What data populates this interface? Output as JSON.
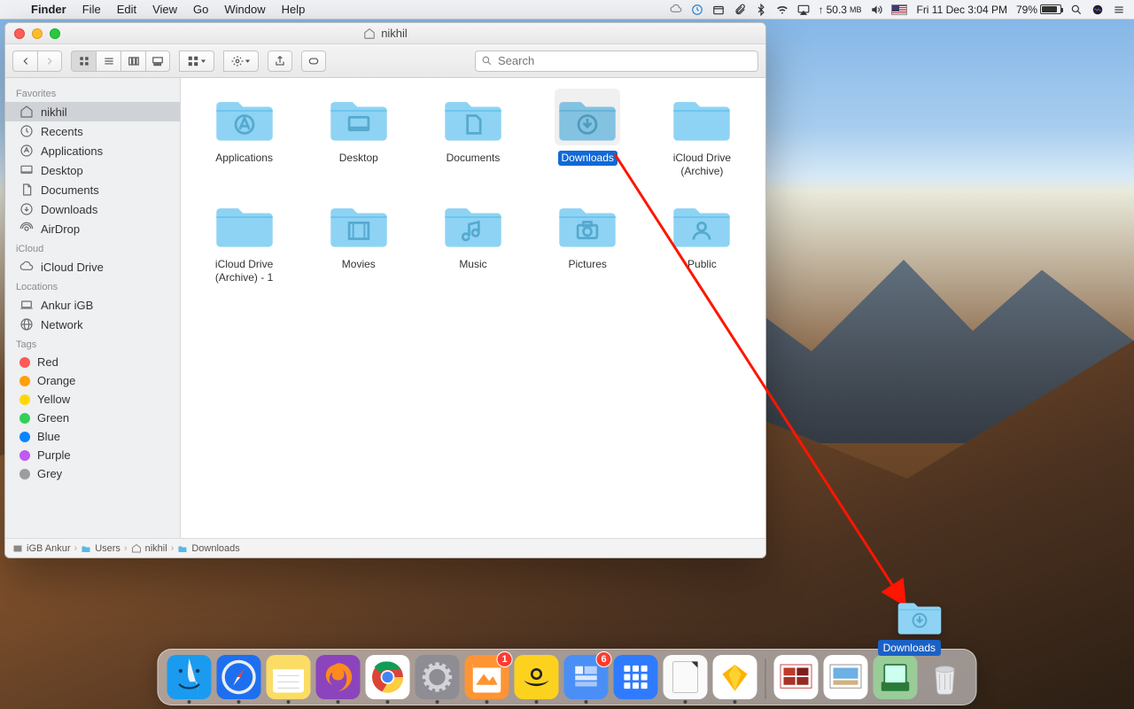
{
  "menubar": {
    "app": "Finder",
    "items": [
      "File",
      "Edit",
      "View",
      "Go",
      "Window",
      "Help"
    ],
    "memory": "50.3",
    "memory_unit": "MB",
    "datetime": "Fri 11 Dec  3:04 PM",
    "battery_pct": "79%"
  },
  "window": {
    "title": "nikhil",
    "search_placeholder": "Search"
  },
  "sidebar": {
    "sections": [
      {
        "title": "Favorites",
        "items": [
          {
            "icon": "home",
            "label": "nikhil",
            "selected": true
          },
          {
            "icon": "clock",
            "label": "Recents"
          },
          {
            "icon": "apps",
            "label": "Applications"
          },
          {
            "icon": "desktop",
            "label": "Desktop"
          },
          {
            "icon": "doc",
            "label": "Documents"
          },
          {
            "icon": "download",
            "label": "Downloads"
          },
          {
            "icon": "airdrop",
            "label": "AirDrop"
          }
        ]
      },
      {
        "title": "iCloud",
        "items": [
          {
            "icon": "cloud",
            "label": "iCloud Drive"
          }
        ]
      },
      {
        "title": "Locations",
        "items": [
          {
            "icon": "laptop",
            "label": "Ankur iGB"
          },
          {
            "icon": "globe",
            "label": "Network"
          }
        ]
      },
      {
        "title": "Tags",
        "items": [
          {
            "tag": "#ff5b56",
            "label": "Red"
          },
          {
            "tag": "#ff9f0a",
            "label": "Orange"
          },
          {
            "tag": "#ffd60a",
            "label": "Yellow"
          },
          {
            "tag": "#30d158",
            "label": "Green"
          },
          {
            "tag": "#0a84ff",
            "label": "Blue"
          },
          {
            "tag": "#bf5af2",
            "label": "Purple"
          },
          {
            "tag": "#9d9ca1",
            "label": "Grey"
          }
        ]
      }
    ]
  },
  "folders": [
    {
      "glyph": "apps",
      "label": "Applications"
    },
    {
      "glyph": "desktop",
      "label": "Desktop"
    },
    {
      "glyph": "doc",
      "label": "Documents"
    },
    {
      "glyph": "download",
      "label": "Downloads",
      "selected": true
    },
    {
      "glyph": "cloud",
      "label": "iCloud Drive (Archive)"
    },
    {
      "glyph": "cloud",
      "label": "iCloud Drive (Archive) - 1"
    },
    {
      "glyph": "movie",
      "label": "Movies"
    },
    {
      "glyph": "music",
      "label": "Music"
    },
    {
      "glyph": "camera",
      "label": "Pictures"
    },
    {
      "glyph": "person",
      "label": "Public"
    }
  ],
  "pathbar": [
    "iGB Ankur",
    "Users",
    "nikhil",
    "Downloads"
  ],
  "dock": {
    "apps": [
      {
        "name": "finder",
        "bg": "#1b9bf0",
        "running": true
      },
      {
        "name": "safari",
        "bg": "#1e6ff0",
        "running": true
      },
      {
        "name": "notes",
        "bg": "#fbdc65",
        "running": true
      },
      {
        "name": "firefox",
        "bg": "#8c44bc",
        "running": true
      },
      {
        "name": "chrome",
        "bg": "#fff",
        "running": true
      },
      {
        "name": "settings",
        "bg": "#8d8d93",
        "running": true
      },
      {
        "name": "pages",
        "bg": "#ff9434",
        "badge": "1",
        "running": true
      },
      {
        "name": "mapper",
        "bg": "#fcd21e",
        "running": true
      },
      {
        "name": "slack",
        "bg": "#4a8ff5",
        "badge": "6",
        "running": true
      },
      {
        "name": "grid",
        "bg": "#2f7bff"
      },
      {
        "name": "libreoffice",
        "bg": "#fafafa",
        "running": true
      },
      {
        "name": "sketch",
        "bg": "#fff",
        "running": true
      }
    ],
    "extras": [
      {
        "name": "photos",
        "bg": "#fff"
      },
      {
        "name": "preview",
        "bg": "#fff"
      },
      {
        "name": "scanner",
        "bg": "#9c9"
      },
      {
        "name": "trash",
        "bg": "transparent"
      }
    ]
  },
  "drag": {
    "label": "Downloads"
  },
  "colors": {
    "folder": "#8ed3f4",
    "folder_dark": "#62bce8",
    "accent": "#1a61c6"
  }
}
